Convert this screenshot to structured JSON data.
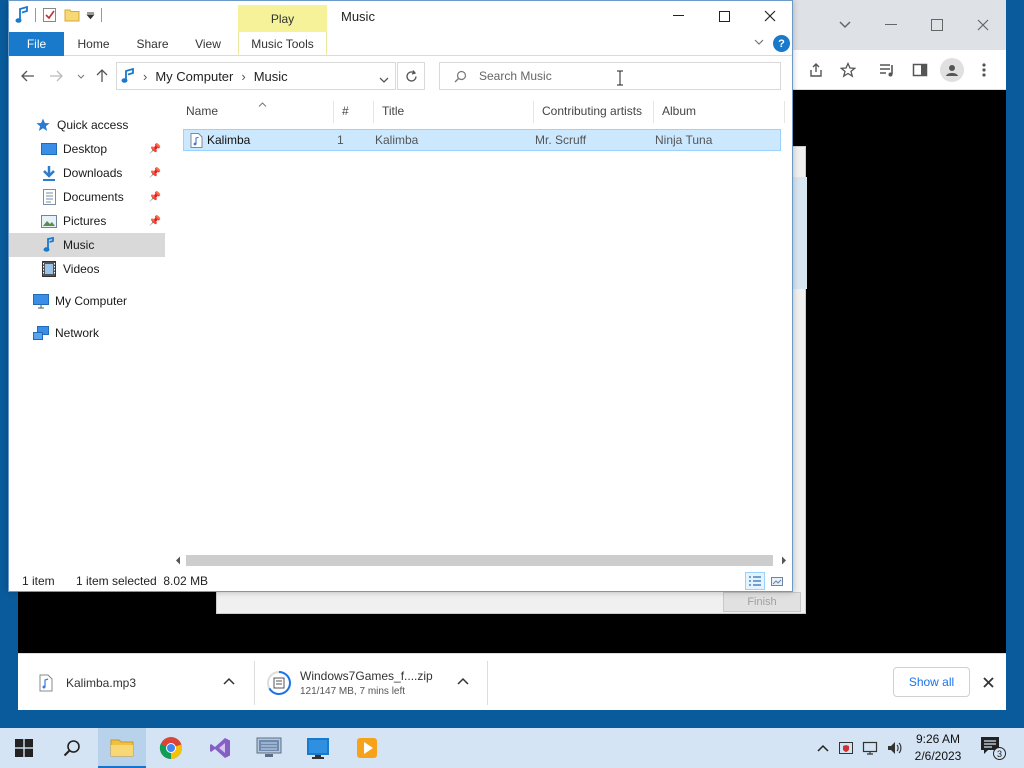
{
  "explorer": {
    "window_title": "Music",
    "contextual_tab": "Play",
    "ribbon_tabs": [
      "File",
      "Home",
      "Share",
      "View",
      "Music Tools"
    ],
    "breadcrumb": [
      "My Computer",
      "Music"
    ],
    "search_placeholder": "Search Music",
    "nav": {
      "quick_access": "Quick access",
      "items": [
        "Desktop",
        "Downloads",
        "Documents",
        "Pictures",
        "Music",
        "Videos"
      ],
      "my_computer": "My Computer",
      "network": "Network"
    },
    "columns": [
      "Name",
      "#",
      "Title",
      "Contributing artists",
      "Album"
    ],
    "rows": [
      {
        "name": "Kalimba",
        "number": "1",
        "title": "Kalimba",
        "artist": "Mr. Scruff",
        "album": "Ninja Tuna"
      }
    ],
    "status": {
      "count": "1 item",
      "selected": "1 item selected  8.02 MB"
    },
    "help": "?"
  },
  "wizard": {
    "finish_label": "Finish"
  },
  "downloads": {
    "items": [
      {
        "name": "Kalimba.mp3"
      },
      {
        "name": "Windows7Games_f....zip",
        "progress": "121/147 MB, 7 mins left"
      }
    ],
    "show_all": "Show all"
  },
  "taskbar": {
    "time": "9:26 AM",
    "date": "2/6/2023",
    "notif_count": "3"
  },
  "colors": {
    "file_tab": "#1979ca",
    "play_tab": "#f5f29a",
    "selection": "#cce8ff",
    "chrome_link": "#1a73e8"
  }
}
